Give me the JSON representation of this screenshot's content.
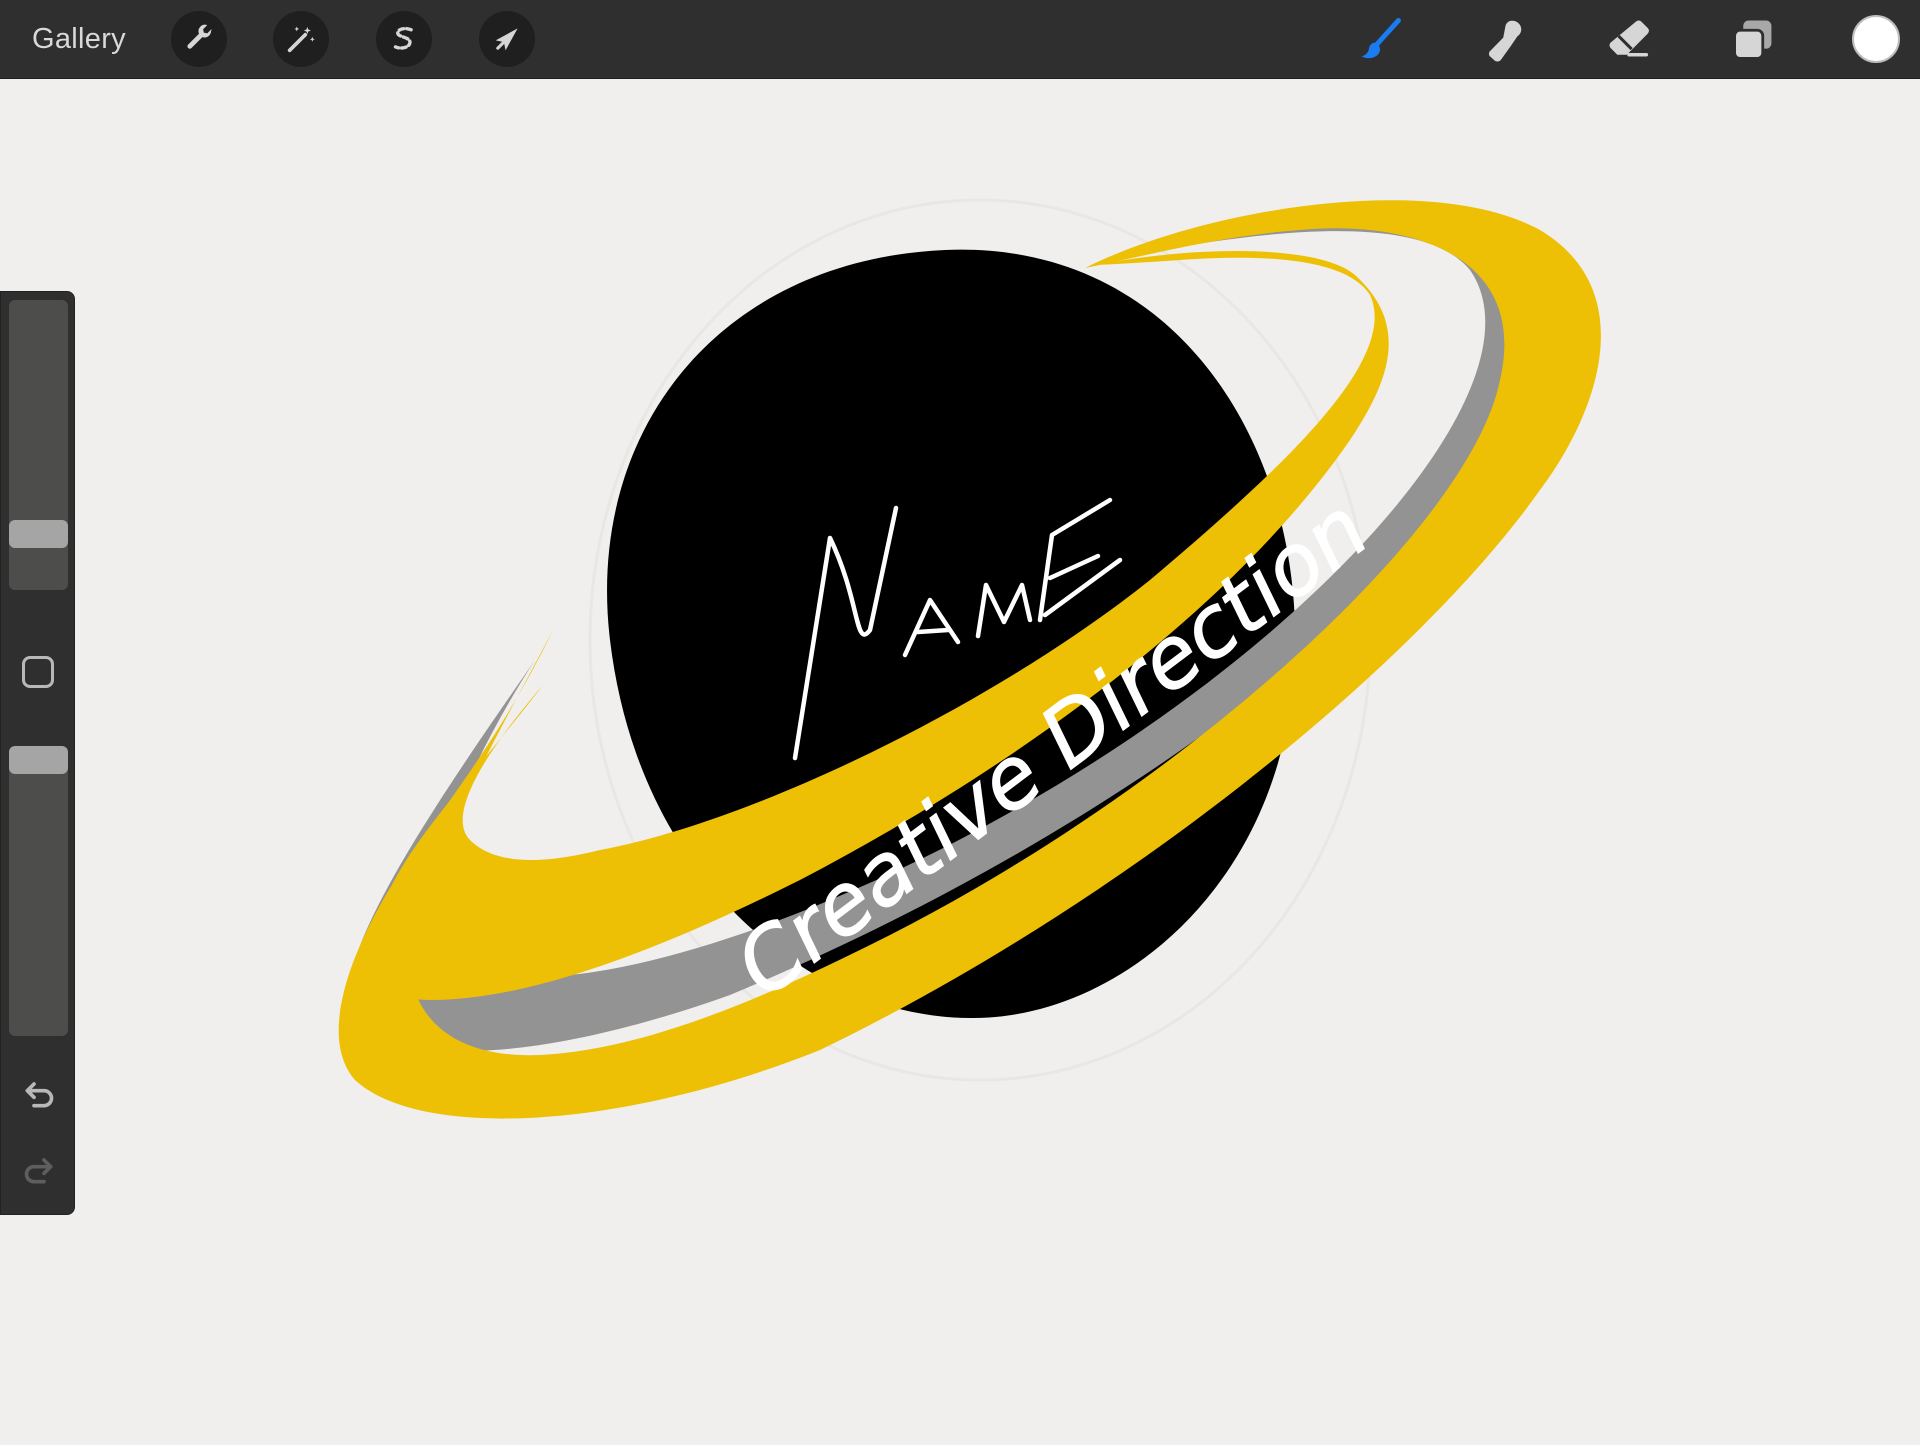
{
  "toolbar": {
    "gallery_label": "Gallery",
    "left_tools": [
      {
        "name": "actions",
        "icon": "wrench-icon"
      },
      {
        "name": "adjustments",
        "icon": "magic-wand-icon"
      },
      {
        "name": "selection",
        "icon": "selection-s-icon"
      },
      {
        "name": "transform",
        "icon": "arrow-cursor-icon"
      }
    ],
    "right_tools": [
      {
        "name": "brush",
        "icon": "paintbrush-icon",
        "active": true
      },
      {
        "name": "smudge",
        "icon": "smudge-finger-icon",
        "active": false
      },
      {
        "name": "eraser",
        "icon": "eraser-icon",
        "active": false
      },
      {
        "name": "layers",
        "icon": "layers-icon",
        "active": false
      }
    ],
    "current_color": "#ffffff",
    "active_color": "#1a7cf0"
  },
  "sidebar": {
    "brush_size_level": 0.75,
    "opacity_level": 0.0,
    "modify_button_icon": "square-outline-icon",
    "undo_icon": "undo-icon",
    "redo_icon": "redo-icon"
  },
  "artwork": {
    "name_text": "NAME",
    "ring_text": "Creative Direction",
    "colors": {
      "planet": "#000000",
      "ring": "#edc005",
      "ring_shadow": "#939393",
      "text": "#ffffff",
      "background": "#f0efed"
    }
  }
}
